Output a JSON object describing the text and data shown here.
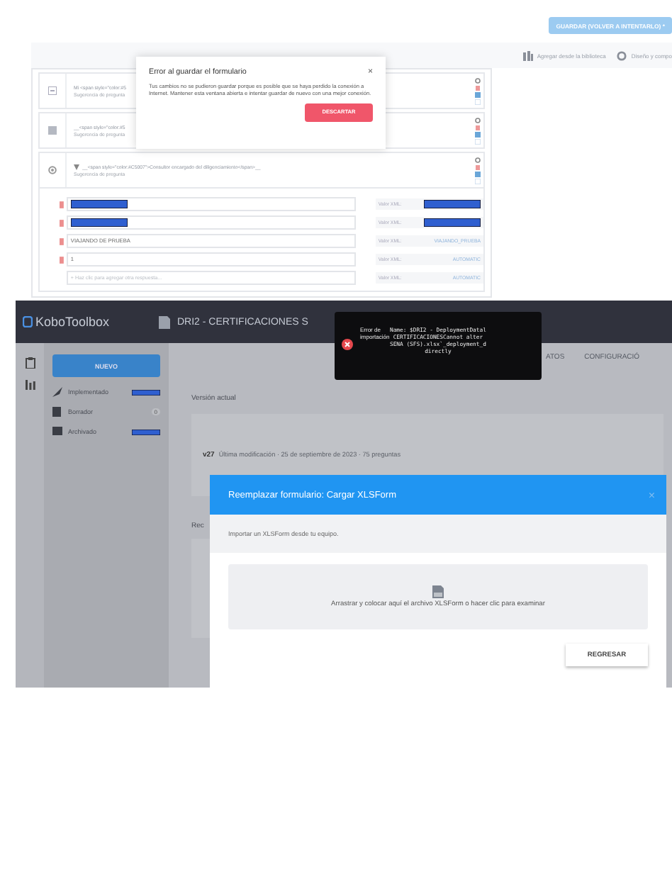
{
  "form_builder": {
    "save_button": "GUARDAR (VOLVER A INTENTARLO) *",
    "toolbar": [
      {
        "kind": "library",
        "label": "Agregar desde la biblioteca"
      },
      {
        "kind": "layout",
        "label": "Diseño y compo"
      }
    ],
    "questions": [
      {
        "label": "Mi <span style=\"color:#5",
        "hint": "Sugerencia de pregunta",
        "kind": "text"
      },
      {
        "label": "__<span style=\"color:#5",
        "hint": "Sugerencia de pregunta",
        "kind": "note"
      },
      {
        "label": "__<span style=\"color:#C5007\">Consultor encargado del diligenciamiento</span>__",
        "hint": "Sugerencia de pregunta",
        "kind": "select",
        "expanded": true
      }
    ],
    "choices": [
      {
        "kind": "redacted",
        "xml_label": "Valor XML:"
      },
      {
        "kind": "redacted",
        "xml_label": "Valor XML:"
      },
      {
        "kind": "text",
        "label": "VIAJANDO DE PRUEBA",
        "xml_label": "Valor XML:",
        "xml_value": "VIAJANDO_PRUEBA"
      },
      {
        "kind": "text",
        "label": "1",
        "xml_label": "Valor XML:",
        "xml_value": "AUTOMATIC"
      },
      {
        "kind": "new",
        "placeholder": "+ Haz clic para agregar otra respuesta...",
        "xml_label": "Valor XML:",
        "xml_value": "AUTOMATIC"
      }
    ],
    "modal": {
      "title": "Error al guardar el formulario",
      "close": "×",
      "message": "Tus cambios no se pudieron guardar porque es posible que se haya perdido la conexión a Internet. Mantener esta ventana abierta e intentar guardar de nuevo con una mejor conexión.",
      "button": "DESCARTAR"
    }
  },
  "kobo": {
    "logo": "KoboToolbox",
    "project_title": "DRI2 - CERTIFICACIONES S",
    "tabs": [
      {
        "label": "ATOS"
      },
      {
        "label": "CONFIGURACIÓ"
      }
    ],
    "new_button": "NUEVO",
    "sidebar": [
      {
        "kind": "redacted",
        "label": "Implementado"
      },
      {
        "kind": "count",
        "label": "Borrador",
        "count": "0"
      },
      {
        "kind": "redacted",
        "label": "Archivado"
      }
    ],
    "current_version_label": "Versión actual",
    "version": {
      "number": "v27",
      "details": "Última modificación · 25 de septiembre de 2023 · 75 preguntas"
    },
    "section_label": "Rec",
    "toast": {
      "title": "Error de importación",
      "lines": [
        "Name: $DRI2 -  DeploymentDatal",
        "CERTIFICACIONESCannot alter",
        "SENA (SFS).xlsx`_deployment_d",
        "directly"
      ]
    },
    "modal": {
      "title": "Reemplazar formulario: Cargar XLSForm",
      "close": "×",
      "subtitle": "Importar un XLSForm desde tu equipo.",
      "dropzone": "Arrastrar y colocar aquí el archivo XLSForm o hacer clic para examinar",
      "button": "REGRESAR"
    }
  }
}
